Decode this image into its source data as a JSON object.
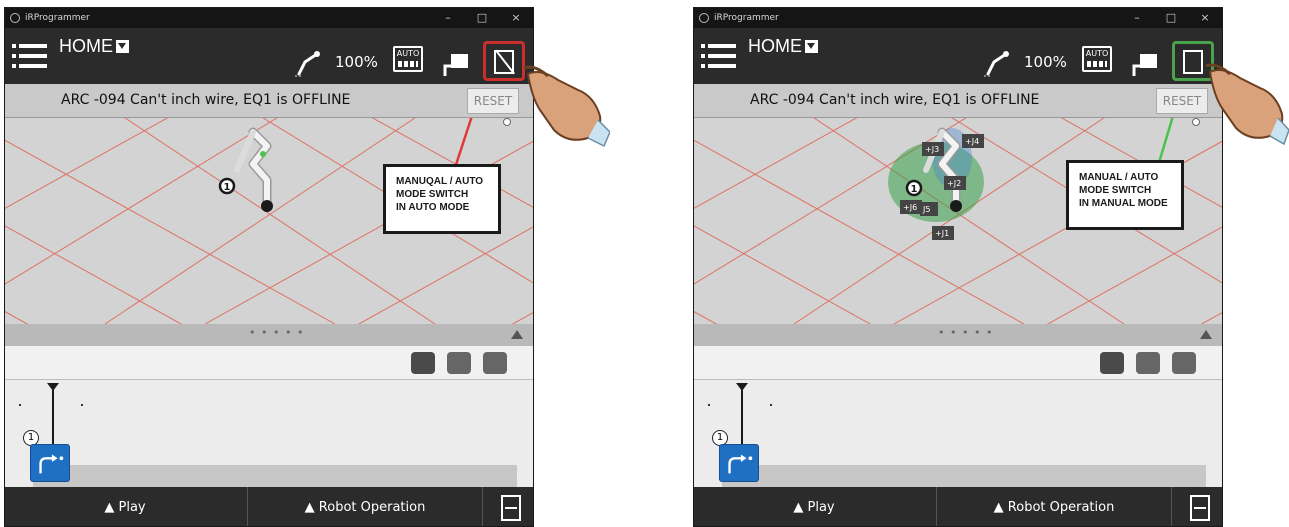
{
  "panels": [
    {
      "app_title": "iRProgrammer",
      "win_min": "–",
      "win_max": "□",
      "win_close": "×",
      "home_label": "HOME",
      "speed": "100%",
      "auto_label": "AUTO",
      "mode": "auto",
      "alarm": "ARC  -094 Can't inch wire, EQ1 is OFFLINE",
      "reset": "RESET",
      "step_number": "1",
      "divider_dots": "• • • • •",
      "play": "▲  Play",
      "robot_operation": "▲  Robot Operation",
      "callout_lines": [
        "MANUQAL / AUTO",
        "MODE SWITCH",
        "IN AUTO MODE"
      ]
    },
    {
      "app_title": "iRProgrammer",
      "win_min": "–",
      "win_max": "□",
      "win_close": "×",
      "home_label": "HOME",
      "speed": "100%",
      "auto_label": "AUTO",
      "mode": "manual",
      "alarm": "ARC  -094 Can't inch wire, EQ1 is OFFLINE",
      "reset": "RESET",
      "step_number": "1",
      "divider_dots": "• • • • •",
      "play": "▲  Play",
      "robot_operation": "▲  Robot Operation",
      "callout_lines": [
        "MANUAL / AUTO",
        "MODE SWITCH",
        "IN MANUAL MODE"
      ],
      "joint_labels": [
        "+J4",
        "+J3",
        "+J2",
        "+J6",
        "J5",
        "+J1"
      ]
    }
  ],
  "colors": {
    "auto_highlight": "#c9302c",
    "manual_highlight": "#4aa34a",
    "toolbar": "#2b2b2b",
    "grid_line": "#e05a4a"
  }
}
